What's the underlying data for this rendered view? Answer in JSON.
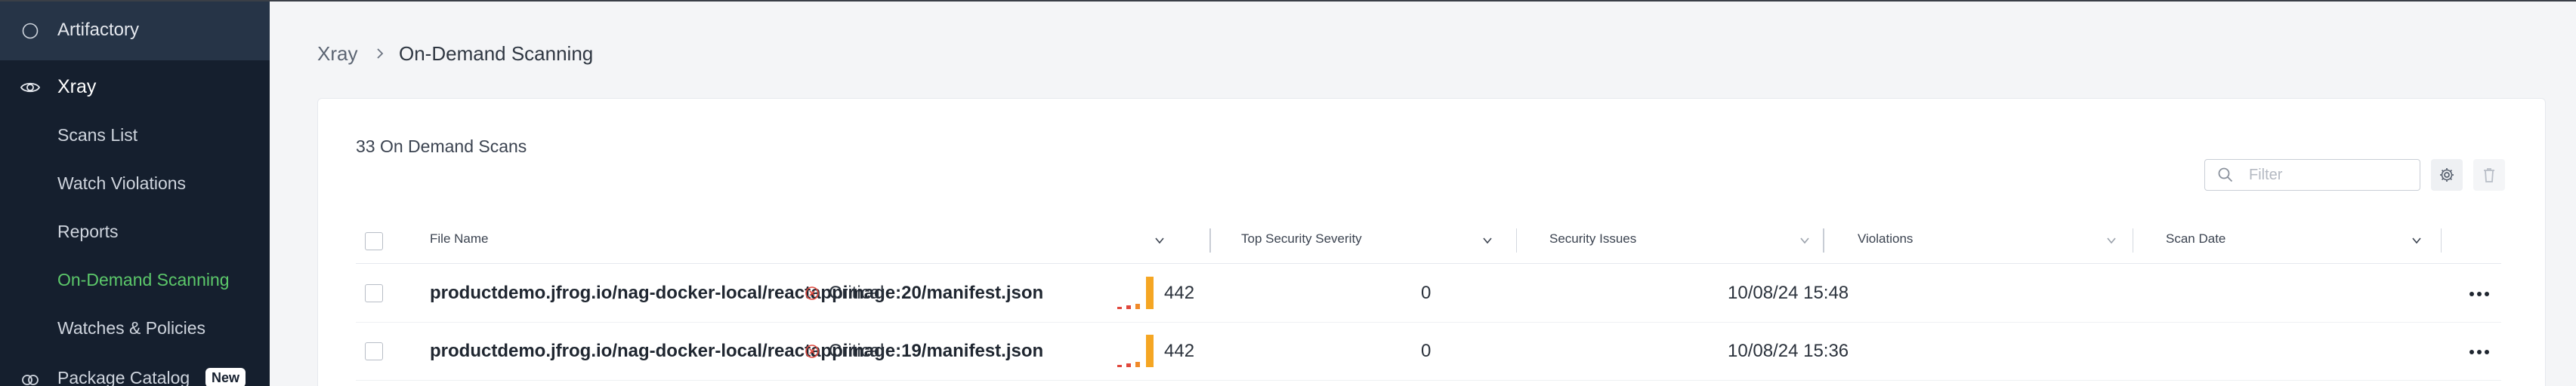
{
  "sidebar": {
    "artifactory_label": "Artifactory",
    "xray_label": "Xray",
    "items": [
      {
        "label": "Scans List"
      },
      {
        "label": "Watch Violations"
      },
      {
        "label": "Reports"
      },
      {
        "label": "On-Demand Scanning"
      },
      {
        "label": "Watches & Policies"
      }
    ],
    "active_item": "On-Demand Scanning",
    "package_catalog_label": "Package Catalog",
    "package_catalog_badge": "New"
  },
  "breadcrumb": {
    "root": "Xray",
    "current": "On-Demand Scanning"
  },
  "panel": {
    "scan_count_label": "33 On Demand Scans",
    "filter_placeholder": "Filter"
  },
  "table": {
    "columns": [
      {
        "label": "File Name"
      },
      {
        "label": "Top Security Severity"
      },
      {
        "label": "Security Issues"
      },
      {
        "label": "Violations"
      },
      {
        "label": "Scan Date"
      }
    ],
    "rows": [
      {
        "file_name": "productdemo.jfrog.io/nag-docker-local/reactappimage:20/manifest.json",
        "severity": "Critical",
        "security_issues": "442",
        "violations": "0",
        "scan_date": "10/08/24 15:48"
      },
      {
        "file_name": "productdemo.jfrog.io/nag-docker-local/reactappimage:19/manifest.json",
        "severity": "Critical",
        "security_issues": "442",
        "violations": "0",
        "scan_date": "10/08/24 15:36"
      }
    ]
  },
  "colors": {
    "sidebar_bg": "#151f2e",
    "sidebar_selected_bg": "#263447",
    "active_green": "#5cc86a",
    "critical_red": "#e0483d",
    "chart_orange": "#f5a623"
  }
}
